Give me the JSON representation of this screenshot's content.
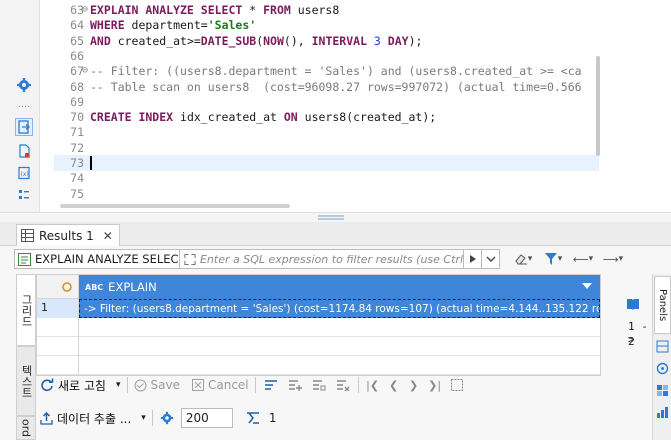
{
  "editor": {
    "lines": [
      {
        "num": "63",
        "fold": "⊖",
        "tokens": [
          [
            "kw",
            "EXPLAIN ANALYZE SELECT "
          ],
          [
            "ident",
            "* "
          ],
          [
            "kw",
            "FROM "
          ],
          [
            "ident",
            "users8"
          ]
        ]
      },
      {
        "num": "64",
        "fold": "",
        "tokens": [
          [
            "kw",
            "WHERE "
          ],
          [
            "ident",
            "department="
          ],
          [
            "str",
            "'Sales'"
          ]
        ]
      },
      {
        "num": "65",
        "fold": "",
        "tokens": [
          [
            "kw",
            "AND "
          ],
          [
            "ident",
            "created_at>="
          ],
          [
            "kw",
            "DATE_SUB"
          ],
          [
            "ident",
            "("
          ],
          [
            "kw",
            "NOW"
          ],
          [
            "ident",
            "(), "
          ],
          [
            "kw",
            "INTERVAL "
          ],
          [
            "num",
            "3 "
          ],
          [
            "kw",
            "DAY"
          ],
          [
            "ident",
            ");"
          ]
        ]
      },
      {
        "num": "66",
        "fold": "",
        "tokens": []
      },
      {
        "num": "67",
        "fold": "⊖",
        "tokens": [
          [
            "cmt",
            "-- Filter: ((users8.department = 'Sales') and (users8.created_at >= <ca"
          ]
        ]
      },
      {
        "num": "68",
        "fold": "",
        "tokens": [
          [
            "cmt",
            "-- Table scan on users8  (cost=96098.27 rows=997072) (actual time=0.566"
          ]
        ]
      },
      {
        "num": "69",
        "fold": "",
        "tokens": []
      },
      {
        "num": "70",
        "fold": "",
        "tokens": [
          [
            "kw",
            "CREATE INDEX "
          ],
          [
            "ident",
            "idx_created_at "
          ],
          [
            "kw",
            "ON "
          ],
          [
            "ident",
            "users8(created_at);"
          ]
        ]
      },
      {
        "num": "71",
        "fold": "",
        "tokens": []
      },
      {
        "num": "72",
        "fold": "",
        "tokens": []
      },
      {
        "num": "73",
        "fold": "",
        "tokens": [],
        "cursor": true
      },
      {
        "num": "74",
        "fold": "",
        "tokens": []
      },
      {
        "num": "75",
        "fold": "",
        "tokens": []
      }
    ]
  },
  "results": {
    "tab_label": "Results 1",
    "tab_close": "✕",
    "query_chip": "EXPLAIN ANALYZE SELEC",
    "filter_placeholder": "Enter a SQL expression to filter results (use Ctrl",
    "grid": {
      "column_type": "ABC",
      "column_name": "EXPLAIN",
      "rows": [
        {
          "num": "1",
          "value": "-> Filter: (users8.department = 'Sales')  (cost=1174.84 rows=107) (actual time=4.144..135.122 rows="
        }
      ]
    },
    "vtabs": {
      "grid": "그리드",
      "text": "텍스트",
      "record": "ord"
    },
    "toolbar1": {
      "refresh": "새로 고침",
      "save": "Save",
      "cancel": "Cancel"
    },
    "toolbar2": {
      "export": "데이터 추출 ...",
      "limit": "200",
      "count": "1"
    },
    "side_values": [
      "1 ->",
      "2"
    ],
    "panels_label": "Panels"
  },
  "colors": {
    "accent": "#3f86d8",
    "keyword": "#7b1b5b",
    "string": "#1a7a1a",
    "comment": "#7a7a7a",
    "number": "#1a3fd0"
  }
}
